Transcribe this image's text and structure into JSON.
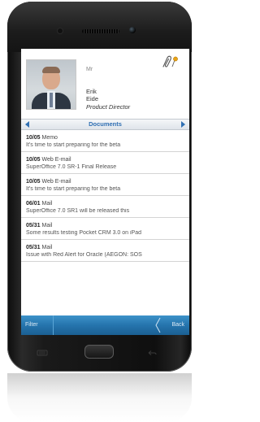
{
  "contact": {
    "title": "Mr",
    "first_name": "Erik",
    "last_name": "Eide",
    "job_title": "Product Director"
  },
  "section": {
    "label": "Documents"
  },
  "documents": [
    {
      "date": "10/05",
      "type": "Memo",
      "text": "It's time to start preparing for the beta"
    },
    {
      "date": "10/05",
      "type": "Web E-mail",
      "text": "SuperOffice 7.0 SR-1 Final Release"
    },
    {
      "date": "10/05",
      "type": "Web E-mail",
      "text": "It's time to start preparing for the beta"
    },
    {
      "date": "06/01",
      "type": "Mail",
      "text": "SuperOffice 7.0 SR1 will be released this"
    },
    {
      "date": "05/31",
      "type": "Mail",
      "text": "Some results testing Pocket CRM 3.0 on iPad"
    },
    {
      "date": "05/31",
      "type": "Mail",
      "text": "Issue with Red Alert for Oracle (AEGON: SOS"
    }
  ],
  "toolbar": {
    "filter_label": "Filter",
    "back_label": "Back"
  },
  "colors": {
    "accent": "#2f6fb3",
    "toolbar": "#2574ad",
    "icon_pin": "#e8a317"
  },
  "icons": {
    "attach": "paperclip-pin-icon",
    "prev": "chevron-left-icon",
    "next": "chevron-right-icon",
    "back": "back-chevron-icon",
    "menu": "menu-icon",
    "home": "home-icon",
    "device_back": "device-back-icon"
  }
}
